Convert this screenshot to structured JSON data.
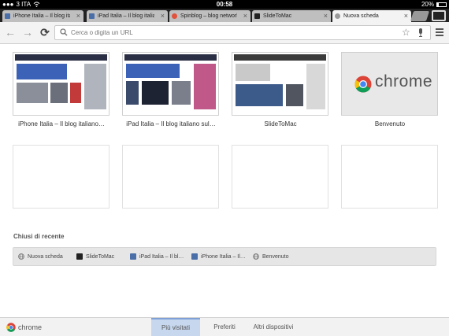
{
  "status_bar": {
    "carrier": "3 ITA",
    "time": "00:58",
    "battery": "20%"
  },
  "tabs": [
    {
      "title": "iPhone Italia – Il blog ita",
      "favicon_color": "#4a6ea8",
      "active": false
    },
    {
      "title": "iPad Italia – Il blog italia",
      "favicon_color": "#4a6ea8",
      "active": false
    },
    {
      "title": "Spinblog – blog network",
      "favicon_color": "#e0523b",
      "active": false
    },
    {
      "title": "SlideToMac",
      "favicon_color": "#222222",
      "active": false
    },
    {
      "title": "Nuova scheda",
      "favicon_color": "#888888",
      "active": true
    }
  ],
  "toolbar": {
    "omnibox_placeholder": "Cerca o digita un URL"
  },
  "most_visited": [
    {
      "label": "iPhone Italia – Il blog italiano…",
      "kind": "site"
    },
    {
      "label": "iPad Italia – Il blog italiano sul…",
      "kind": "site"
    },
    {
      "label": "SlideToMac",
      "kind": "site"
    },
    {
      "label": "Benvenuto",
      "kind": "chrome",
      "word": "chrome"
    }
  ],
  "recently_closed": {
    "title": "Chiusi di recente",
    "items": [
      {
        "label": "Nuova scheda",
        "icon": "globe-icon"
      },
      {
        "label": "SlideToMac",
        "icon": "slidetomac-icon"
      },
      {
        "label": "iPad Italia – Il bl…",
        "icon": "ipad-italia-icon"
      },
      {
        "label": "iPhone Italia – Il…",
        "icon": "iphone-italia-icon"
      },
      {
        "label": "Benvenuto",
        "icon": "globe-icon"
      }
    ]
  },
  "bottom_bar": {
    "brand": "chrome",
    "tabs": [
      {
        "label": "Più visitati",
        "active": true
      },
      {
        "label": "Preferiti",
        "active": false
      },
      {
        "label": "Altri dispositivi",
        "active": false
      }
    ]
  },
  "colors": {
    "accent_tab": "#c6d7ee",
    "toolbar_bg": "#f3f3f3"
  }
}
